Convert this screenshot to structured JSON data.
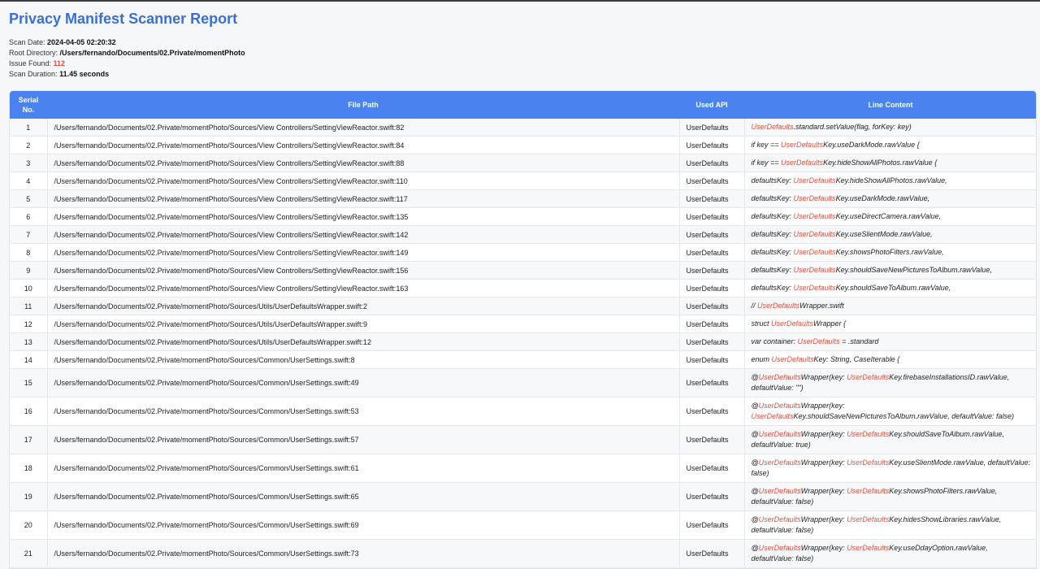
{
  "report": {
    "title": "Privacy Manifest Scanner Report",
    "scan_date_label": "Scan Date:",
    "scan_date": "2024-04-05 02:20:32",
    "root_dir_label": "Root Directory:",
    "root_dir": "/Users/fernando/Documents/02.Private/momentPhoto",
    "issues_label": "Issue Found:",
    "issues": "112",
    "duration_label": "Scan Duration:",
    "duration": "11.45 seconds"
  },
  "table": {
    "headers": {
      "serial": "Serial No.",
      "path": "File Path",
      "api": "Used API",
      "line": "Line Content"
    },
    "highlight_color": "#e05140",
    "header_color": "#4a83f0",
    "rows": [
      {
        "serial": "1",
        "path": "/Users/fernando/Documents/02.Private/momentPhoto/Sources/View Controllers/SettingViewReactor.swift:82",
        "api": "UserDefaults",
        "line": [
          [
            "",
            "UserDefaults"
          ],
          [
            ".standard.setValue(flag, forKey: key)",
            ""
          ]
        ]
      },
      {
        "serial": "2",
        "path": "/Users/fernando/Documents/02.Private/momentPhoto/Sources/View Controllers/SettingViewReactor.swift:84",
        "api": "UserDefaults",
        "line": [
          [
            "if key == ",
            "UserDefaults"
          ],
          [
            "Key.useDarkMode.rawValue {",
            ""
          ]
        ]
      },
      {
        "serial": "3",
        "path": "/Users/fernando/Documents/02.Private/momentPhoto/Sources/View Controllers/SettingViewReactor.swift:88",
        "api": "UserDefaults",
        "line": [
          [
            "if key == ",
            "UserDefaults"
          ],
          [
            "Key.hideShowAllPhotos.rawValue {",
            ""
          ]
        ]
      },
      {
        "serial": "4",
        "path": "/Users/fernando/Documents/02.Private/momentPhoto/Sources/View Controllers/SettingViewReactor.swift:110",
        "api": "UserDefaults",
        "line": [
          [
            "defaultsKey: ",
            "UserDefaults"
          ],
          [
            "Key.hideShowAllPhotos.rawValue,",
            ""
          ]
        ]
      },
      {
        "serial": "5",
        "path": "/Users/fernando/Documents/02.Private/momentPhoto/Sources/View Controllers/SettingViewReactor.swift:117",
        "api": "UserDefaults",
        "line": [
          [
            "defaultsKey: ",
            "UserDefaults"
          ],
          [
            "Key.useDarkMode.rawValue,",
            ""
          ]
        ]
      },
      {
        "serial": "6",
        "path": "/Users/fernando/Documents/02.Private/momentPhoto/Sources/View Controllers/SettingViewReactor.swift:135",
        "api": "UserDefaults",
        "line": [
          [
            "defaultsKey: ",
            "UserDefaults"
          ],
          [
            "Key.useDirectCamera.rawValue,",
            ""
          ]
        ]
      },
      {
        "serial": "7",
        "path": "/Users/fernando/Documents/02.Private/momentPhoto/Sources/View Controllers/SettingViewReactor.swift:142",
        "api": "UserDefaults",
        "line": [
          [
            "defaultsKey: ",
            "UserDefaults"
          ],
          [
            "Key.useSlientMode.rawValue,",
            ""
          ]
        ]
      },
      {
        "serial": "8",
        "path": "/Users/fernando/Documents/02.Private/momentPhoto/Sources/View Controllers/SettingViewReactor.swift:149",
        "api": "UserDefaults",
        "line": [
          [
            "defaultsKey: ",
            "UserDefaults"
          ],
          [
            "Key.showsPhotoFilters.rawValue,",
            ""
          ]
        ]
      },
      {
        "serial": "9",
        "path": "/Users/fernando/Documents/02.Private/momentPhoto/Sources/View Controllers/SettingViewReactor.swift:156",
        "api": "UserDefaults",
        "line": [
          [
            "defaultsKey: ",
            "UserDefaults"
          ],
          [
            "Key.shouldSaveNewPicturesToAlbum.rawValue,",
            ""
          ]
        ]
      },
      {
        "serial": "10",
        "path": "/Users/fernando/Documents/02.Private/momentPhoto/Sources/View Controllers/SettingViewReactor.swift:163",
        "api": "UserDefaults",
        "line": [
          [
            "defaultsKey: ",
            "UserDefaults"
          ],
          [
            "Key.shouldSaveToAlbum.rawValue,",
            ""
          ]
        ]
      },
      {
        "serial": "11",
        "path": "/Users/fernando/Documents/02.Private/momentPhoto/Sources/Utils/UserDefaultsWrapper.swift:2",
        "api": "UserDefaults",
        "line": [
          [
            "//  ",
            "UserDefaults"
          ],
          [
            "Wrapper.swift",
            ""
          ]
        ]
      },
      {
        "serial": "12",
        "path": "/Users/fernando/Documents/02.Private/momentPhoto/Sources/Utils/UserDefaultsWrapper.swift:9",
        "api": "UserDefaults",
        "line": [
          [
            "struct ",
            "UserDefaults"
          ],
          [
            "Wrapper {",
            ""
          ]
        ]
      },
      {
        "serial": "13",
        "path": "/Users/fernando/Documents/02.Private/momentPhoto/Sources/Utils/UserDefaultsWrapper.swift:12",
        "api": "UserDefaults",
        "line": [
          [
            "var container: ",
            "UserDefaults"
          ],
          [
            " = .standard",
            ""
          ]
        ]
      },
      {
        "serial": "14",
        "path": "/Users/fernando/Documents/02.Private/momentPhoto/Sources/Common/UserSettings.swift:8",
        "api": "UserDefaults",
        "line": [
          [
            "enum ",
            "UserDefaults"
          ],
          [
            "Key: String, CaseIterable {",
            ""
          ]
        ]
      },
      {
        "serial": "15",
        "path": "/Users/fernando/Documents/02.Private/momentPhoto/Sources/Common/UserSettings.swift:49",
        "api": "UserDefaults",
        "line": [
          [
            "@",
            "UserDefaults"
          ],
          [
            "Wrapper(key: ",
            "UserDefaults"
          ],
          [
            "Key.firebaseInstallationsID.rawValue, defaultValue: \"\")",
            ""
          ]
        ]
      },
      {
        "serial": "16",
        "path": "/Users/fernando/Documents/02.Private/momentPhoto/Sources/Common/UserSettings.swift:53",
        "api": "UserDefaults",
        "line": [
          [
            "@",
            "UserDefaults"
          ],
          [
            "Wrapper(key: ",
            "UserDefaults"
          ],
          [
            "Key.shouldSaveNewPicturesToAlbum.rawValue, defaultValue: false)",
            ""
          ]
        ]
      },
      {
        "serial": "17",
        "path": "/Users/fernando/Documents/02.Private/momentPhoto/Sources/Common/UserSettings.swift:57",
        "api": "UserDefaults",
        "line": [
          [
            "@",
            "UserDefaults"
          ],
          [
            "Wrapper(key: ",
            "UserDefaults"
          ],
          [
            "Key.shouldSaveToAlbum.rawValue, defaultValue: true)",
            ""
          ]
        ]
      },
      {
        "serial": "18",
        "path": "/Users/fernando/Documents/02.Private/momentPhoto/Sources/Common/UserSettings.swift:61",
        "api": "UserDefaults",
        "line": [
          [
            "@",
            "UserDefaults"
          ],
          [
            "Wrapper(key: ",
            "UserDefaults"
          ],
          [
            "Key.useSlientMode.rawValue, defaultValue: false)",
            ""
          ]
        ]
      },
      {
        "serial": "19",
        "path": "/Users/fernando/Documents/02.Private/momentPhoto/Sources/Common/UserSettings.swift:65",
        "api": "UserDefaults",
        "line": [
          [
            "@",
            "UserDefaults"
          ],
          [
            "Wrapper(key: ",
            "UserDefaults"
          ],
          [
            "Key.showsPhotoFilters.rawValue, defaultValue: false)",
            ""
          ]
        ]
      },
      {
        "serial": "20",
        "path": "/Users/fernando/Documents/02.Private/momentPhoto/Sources/Common/UserSettings.swift:69",
        "api": "UserDefaults",
        "line": [
          [
            "@",
            "UserDefaults"
          ],
          [
            "Wrapper(key: ",
            "UserDefaults"
          ],
          [
            "Key.hidesShowLibraries.rawValue, defaultValue: false)",
            ""
          ]
        ]
      },
      {
        "serial": "21",
        "path": "/Users/fernando/Documents/02.Private/momentPhoto/Sources/Common/UserSettings.swift:73",
        "api": "UserDefaults",
        "line": [
          [
            "@",
            "UserDefaults"
          ],
          [
            "Wrapper(key: ",
            "UserDefaults"
          ],
          [
            "Key.useDdayOption.rawValue, defaultValue: false)",
            ""
          ]
        ]
      }
    ]
  }
}
